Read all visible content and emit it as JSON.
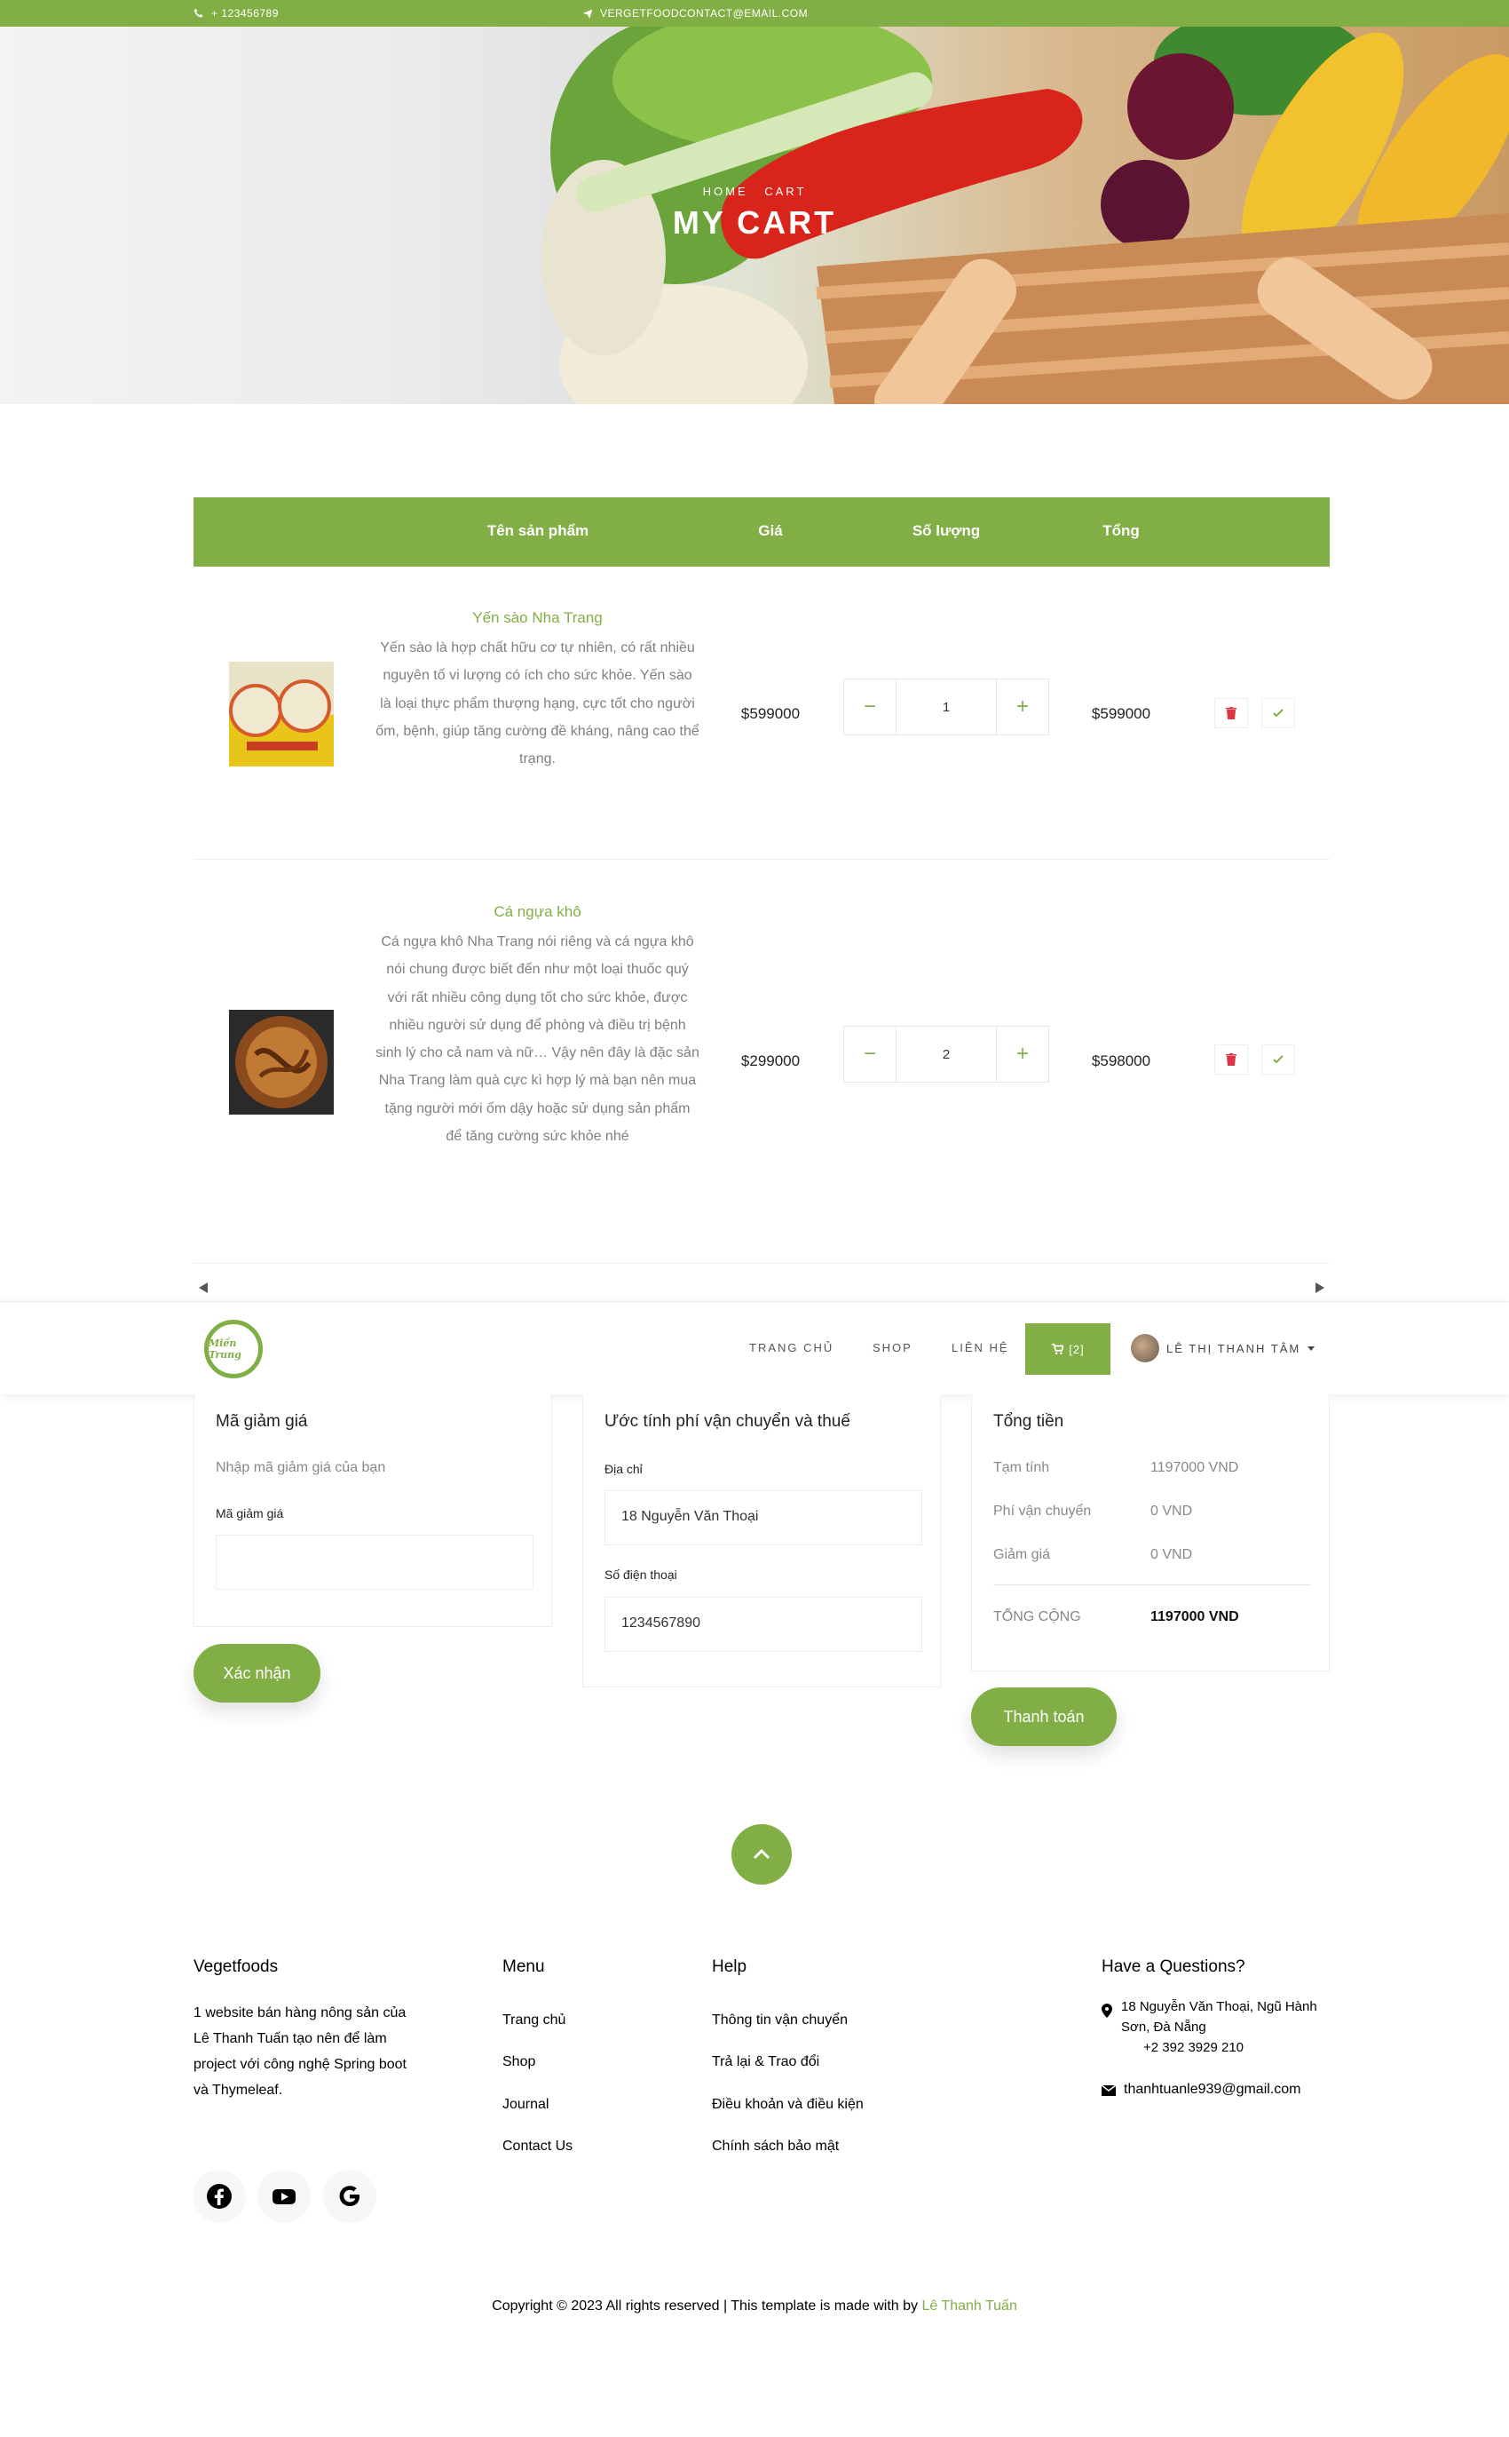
{
  "topbar": {
    "phone": "+ 123456789",
    "email": "VERGETFOODCONTACT@EMAIL.COM"
  },
  "hero": {
    "breadcrumb_home": "HOME",
    "breadcrumb_cart": "CART",
    "title": "MY CART"
  },
  "cart": {
    "headers": {
      "product": "Tên sản phẩm",
      "price": "Giá",
      "quantity": "Số lượng",
      "total": "Tổng"
    },
    "items": [
      {
        "name": "Yến sào Nha Trang",
        "description": "Yến sào là hợp chất hữu cơ tự nhiên, có rất nhiều nguyên tố vi lượng có ích cho sức khỏe. Yến sào là loại thực phẩm thượng hạng, cực tốt cho người ốm, bệnh, giúp tăng cường đề kháng, nâng cao thể trạng.",
        "price": "$599000",
        "quantity": "1",
        "total": "$599000",
        "minus": "−",
        "plus": "+"
      },
      {
        "name": "Cá ngựa khô",
        "description": "Cá ngựa khô Nha Trang nói riêng và cá ngựa khô nói chung được biết đến như một loại thuốc quý với rất nhiều công dụng tốt cho sức khỏe, được nhiều người sử dụng để phòng và điều trị bệnh sinh lý cho cả nam và nữ… Vậy nên đây là đặc sản Nha Trang làm quà cực kì hợp lý mà bạn nên mua tặng người mới ốm dậy hoặc sử dụng sản phẩm để tăng cường sức khỏe nhé",
        "price": "$299000",
        "quantity": "2",
        "total": "$598000",
        "minus": "−",
        "plus": "+"
      }
    ]
  },
  "nav": {
    "logo_text": "Miền Trung",
    "links": [
      "TRANG CHỦ",
      "SHOP",
      "LIÊN HỆ"
    ],
    "cart_label": "[2]",
    "user_name": "LÊ THỊ THANH TÂM"
  },
  "coupon": {
    "title": "Mã giảm giá",
    "hint": "Nhập mã giảm giá của bạn",
    "field_label": "Mã giảm giá",
    "field_value": "",
    "button": "Xác nhận"
  },
  "shipping": {
    "title": "Ước tính phí vận chuyển và thuế",
    "address_label": "Địa chỉ",
    "address_value": "18 Nguyễn Văn Thoại",
    "phone_label": "Số điện thoại",
    "phone_value": "1234567890"
  },
  "summary": {
    "title": "Tổng tiền",
    "subtotal_label": "Tạm tính",
    "subtotal_value": "1197000 VND",
    "shipping_label": "Phí vận chuyển",
    "shipping_value": "0 VND",
    "discount_label": "Giảm giá",
    "discount_value": "0 VND",
    "total_label": "TỔNG CỘNG",
    "total_value": "1197000 VND",
    "button": "Thanh toán"
  },
  "footer": {
    "brand_title": "Vegetfoods",
    "brand_text": "1 website bán hàng nông sản của Lê Thanh Tuấn tạo nên để làm project với công nghệ Spring boot và Thymeleaf.",
    "menu_title": "Menu",
    "menu_items": [
      "Trang chủ",
      "Shop",
      "Journal",
      "Contact Us"
    ],
    "help_title": "Help",
    "help_items": [
      "Thông tin vận chuyển",
      "Trả lại & Trao đổi",
      "Điều khoản và điều kiện",
      "Chính sách bảo mật"
    ],
    "contact_title": "Have a Questions?",
    "address": "18 Nguyễn Văn Thoại, Ngũ Hành Sơn, Đà Nẵng",
    "phone": "+2 392 3929 210",
    "email": "thanhtuanle939@gmail.com",
    "copyright": "Copyright © 2023 All rights reserved | This template is made with by",
    "author": "Lê Thanh Tuấn"
  },
  "icons": {
    "social": [
      "facebook-icon",
      "youtube-icon",
      "google-icon"
    ]
  },
  "colors": {
    "accent": "#82ae46",
    "danger": "#dc3545"
  }
}
